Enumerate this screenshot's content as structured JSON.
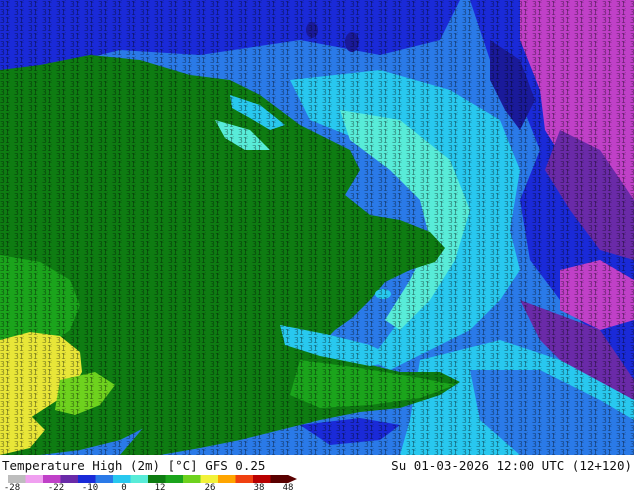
{
  "map": {
    "title": "Temperature High (2m) [°C] GFS 0.25",
    "valid_time": "Su 01-03-2026 12:00 UTC (12+120)"
  },
  "legend": {
    "ticks": [
      "-28",
      "-22",
      "-10",
      "0",
      "12",
      "26",
      "38",
      "48"
    ],
    "colors": [
      "#bdbdbd",
      "#f0a0f0",
      "#c040c8",
      "#6a2aa8",
      "#1a2ad8",
      "#2a7ae8",
      "#28c8ef",
      "#58ecd8",
      "#0e7c12",
      "#1ba41c",
      "#6ed21e",
      "#f2f23a",
      "#ffa500",
      "#f04010",
      "#b80000",
      "#5a0000"
    ]
  },
  "colors": {
    "land": "#0e7c12",
    "land_light": "#1ba41c",
    "warm": "#e8e638",
    "sea_cold": "#1a2ad8",
    "sea_mid": "#2a7ae8",
    "sea_warm": "#28c8ef",
    "sea_pale": "#58ecd8",
    "deep": "#1a1a9a",
    "magenta": "#c040c8",
    "purple": "#6a2aa8"
  }
}
